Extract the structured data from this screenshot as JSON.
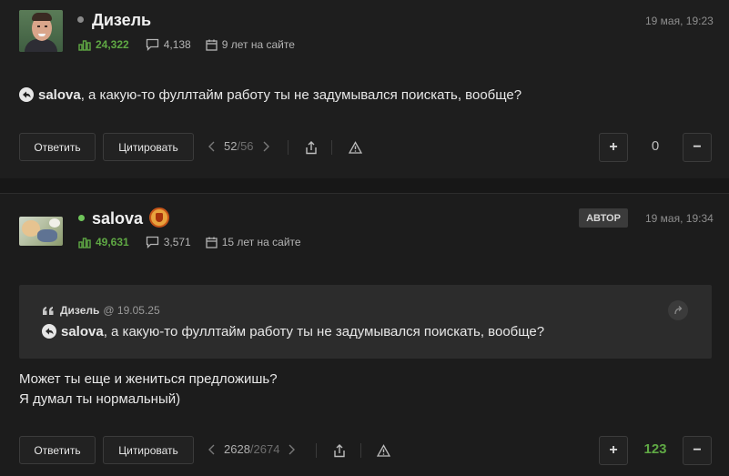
{
  "post1": {
    "author": "Дизель",
    "status_color": "#8a8a8a",
    "date": "19 мая, 19:23",
    "rating": "24,322",
    "comments": "4,138",
    "tenure": "9 лет на сайте",
    "mention": "salova",
    "text": ", а какую-то фуллтайм работу ты не задумывался поискать, вообще?",
    "reply_label": "Ответить",
    "quote_label": "Цитировать",
    "page_current": "52",
    "page_total": "/56",
    "score": "0",
    "score_color": "#bdbdbd",
    "plus": "+",
    "minus": "−"
  },
  "post2": {
    "author": "salova",
    "status_color": "#6fc55a",
    "author_badge": "АВТОР",
    "date": "19 мая, 19:34",
    "rating": "49,631",
    "comments": "3,571",
    "tenure": "15 лет на сайте",
    "quote": {
      "author": "Дизель",
      "date": "@ 19.05.25",
      "mention": "salova",
      "text": ", а какую-то фуллтайм работу ты не задумывался поискать, вообще?"
    },
    "text_line1": "Может ты еще и жениться предложишь?",
    "text_line2": "Я думал ты нормальный)",
    "reply_label": "Ответить",
    "quote_label": "Цитировать",
    "page_current": "2628",
    "page_total": "/2674",
    "score": "123",
    "score_color": "#5fa844",
    "plus": "+",
    "minus": "−"
  },
  "icons": {
    "rating": "bar-chart-icon",
    "comments": "comment-icon",
    "tenure": "calendar-icon",
    "share": "share-icon",
    "report": "warning-icon",
    "reply": "reply-icon",
    "quote": "quote-icon",
    "jump": "jump-to-quote-icon"
  }
}
